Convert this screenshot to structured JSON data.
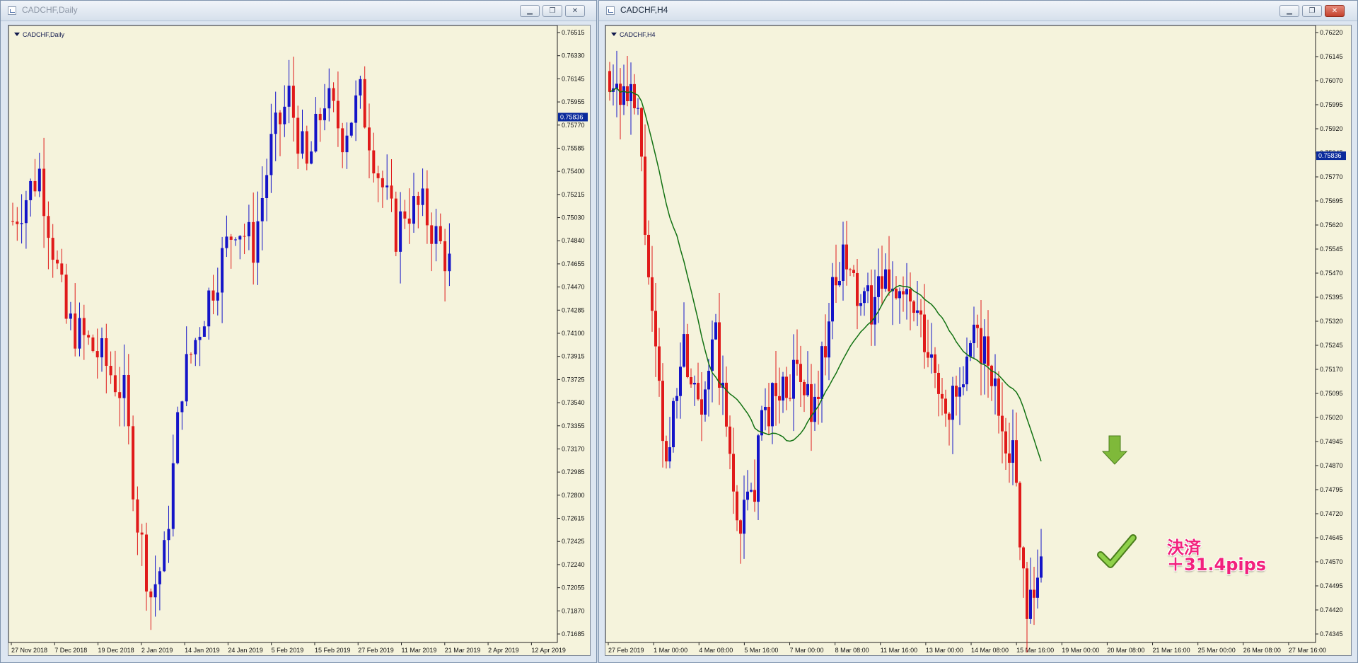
{
  "windows": [
    {
      "title": "CADCHF,Daily",
      "chart_label": "CADCHF,Daily",
      "current_price": "0.75836",
      "price_ticks": [
        "0.76515",
        "0.76330",
        "0.76145",
        "0.75955",
        "0.75770",
        "0.75585",
        "0.75400",
        "0.75215",
        "0.75030",
        "0.74840",
        "0.74655",
        "0.74470",
        "0.74285",
        "0.74100",
        "0.73915",
        "0.73725",
        "0.73540",
        "0.73355",
        "0.73170",
        "0.72985",
        "0.72800",
        "0.72615",
        "0.72425",
        "0.72240",
        "0.72055",
        "0.71870",
        "0.71685"
      ],
      "time_ticks": [
        "27 Nov 2018",
        "7 Dec 2018",
        "19 Dec 2018",
        "2 Jan 2019",
        "14 Jan 2019",
        "24 Jan 2019",
        "5 Feb 2019",
        "15 Feb 2019",
        "27 Feb 2019",
        "11 Mar 2019",
        "21 Mar 2019",
        "2 Apr 2019",
        "12 Apr 2019"
      ],
      "buttons": {
        "minimize": "▁",
        "maximize": "❐",
        "close": "✕"
      }
    },
    {
      "title": "CADCHF,H4",
      "chart_label": "CADCHF,H4",
      "current_price": "0.75836",
      "price_ticks": [
        "0.76220",
        "0.76145",
        "0.76070",
        "0.75995",
        "0.75920",
        "0.75845",
        "0.75770",
        "0.75695",
        "0.75620",
        "0.75545",
        "0.75470",
        "0.75395",
        "0.75320",
        "0.75245",
        "0.75170",
        "0.75095",
        "0.75020",
        "0.74945",
        "0.74870",
        "0.74795",
        "0.74720",
        "0.74645",
        "0.74570",
        "0.74495",
        "0.74420",
        "0.74345"
      ],
      "time_ticks": [
        "27 Feb 2019",
        "1 Mar 00:00",
        "4 Mar 08:00",
        "5 Mar 16:00",
        "7 Mar 00:00",
        "8 Mar 08:00",
        "11 Mar 16:00",
        "13 Mar 00:00",
        "14 Mar 08:00",
        "15 Mar 16:00",
        "19 Mar 00:00",
        "20 Mar 08:00",
        "21 Mar 16:00",
        "25 Mar 00:00",
        "26 Mar 08:00",
        "27 Mar 16:00"
      ],
      "annotation": {
        "line1": "決済",
        "line2": "＋31.4pips"
      },
      "buttons": {
        "minimize": "▁",
        "maximize": "❐",
        "close": "✕"
      }
    }
  ],
  "colors": {
    "bull": "#1414c8",
    "bear": "#e01a1a",
    "ma": "#127212",
    "chart_bg": "#f5f3dc",
    "current_price_bg": "#0a2a9c",
    "exit_arrow": "#7fb93a",
    "annotation": "#f2217d"
  },
  "icons": [
    "chart-window-icon",
    "minimize-icon",
    "maximize-icon",
    "close-icon",
    "down-arrow-icon",
    "checkmark-icon"
  ]
}
